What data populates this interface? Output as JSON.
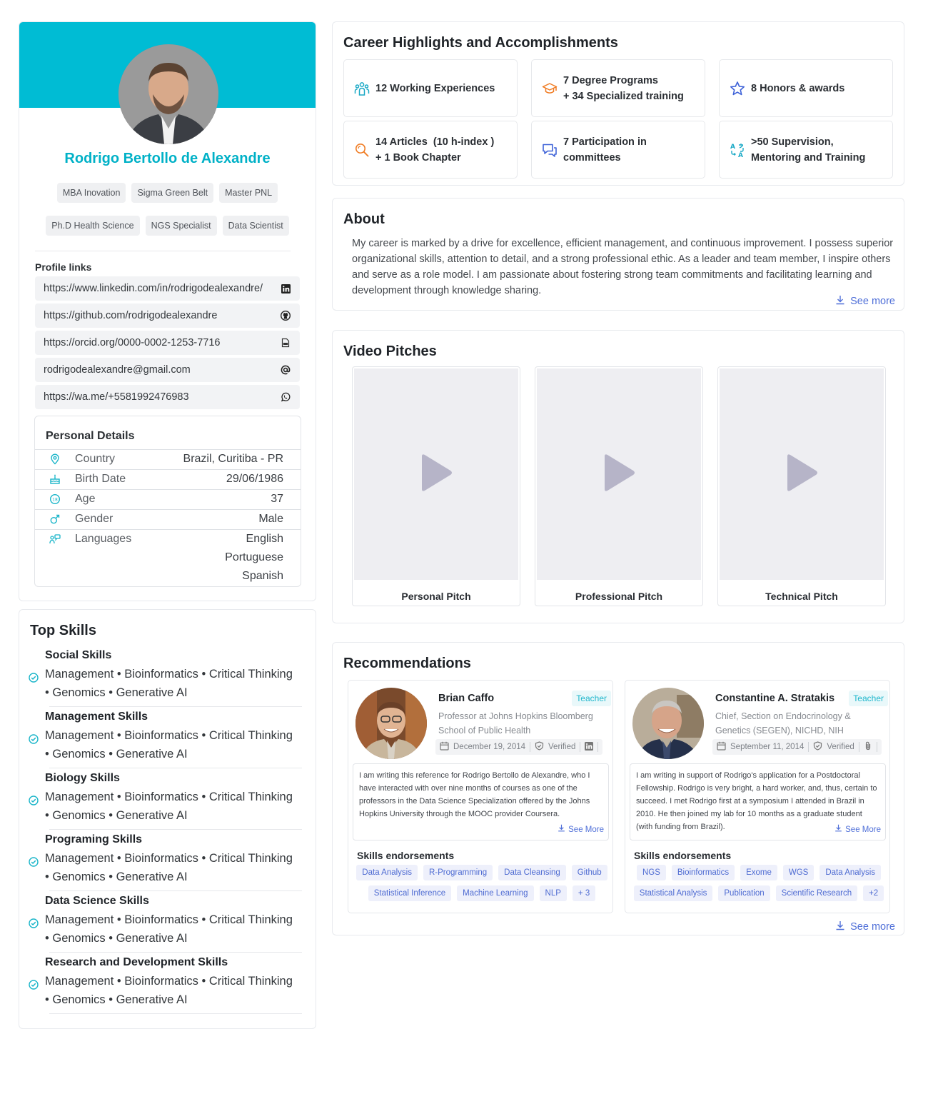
{
  "profile": {
    "name": "Rodrigo Bertollo de Alexandre",
    "tags_row1": [
      "MBA Inovation",
      "Sigma Green Belt",
      "Master PNL"
    ],
    "tags_row2": [
      "Ph.D Health Science",
      "NGS Specialist",
      "Data Scientist"
    ],
    "links_title": "Profile links",
    "links": [
      {
        "text": "https://www.linkedin.com/in/rodrigodealexandre/",
        "icon": "linkedin-icon"
      },
      {
        "text": "https://github.com/rodrigodealexandre",
        "icon": "github-icon"
      },
      {
        "text": "https://orcid.org/0000-0002-1253-7716",
        "icon": "orcid-icon"
      },
      {
        "text": "rodrigodealexandre@gmail.com",
        "icon": "at-icon"
      },
      {
        "text": "https://wa.me/+5581992476983",
        "icon": "whatsapp-icon"
      }
    ],
    "personal": {
      "title": "Personal Details",
      "rows": [
        {
          "label": "Country",
          "value": "Brazil, Curitiba - PR",
          "icon": "location-icon"
        },
        {
          "label": "Birth Date",
          "value": "29/06/1986",
          "icon": "cake-icon"
        },
        {
          "label": "Age",
          "value": "37",
          "icon": "age-icon"
        },
        {
          "label": "Gender",
          "value": "Male",
          "icon": "male-icon"
        },
        {
          "label": "Languages",
          "values": [
            "English",
            "Portuguese",
            "Spanish"
          ],
          "icon": "language-icon"
        }
      ]
    }
  },
  "skills": {
    "title": "Top Skills",
    "groups": [
      {
        "name": "Social Skills",
        "line1": "Management • Bioinformatics • Critical Thinking",
        "line2": "• Genomics • Generative AI"
      },
      {
        "name": "Management Skills",
        "line1": "Management • Bioinformatics • Critical Thinking",
        "line2": "• Genomics • Generative AI"
      },
      {
        "name": "Biology Skills",
        "line1": "Management • Bioinformatics • Critical Thinking",
        "line2": "• Genomics • Generative AI"
      },
      {
        "name": "Programing Skills",
        "line1": "Management • Bioinformatics • Critical Thinking",
        "line2": "• Genomics • Generative AI"
      },
      {
        "name": "Data Science Skills",
        "line1": "Management • Bioinformatics • Critical Thinking",
        "line2": "• Genomics • Generative AI"
      },
      {
        "name": "Research and Development Skills",
        "line1": "Management • Bioinformatics • Critical Thinking",
        "line2": "• Genomics • Generative AI"
      }
    ]
  },
  "career": {
    "title": "Career Highlights and Accomplishments",
    "items": [
      {
        "line1": "12 Working Experiences",
        "line2": "",
        "icon": "team-icon",
        "color": "#1aa9c6"
      },
      {
        "line1": "7 Degree Programs",
        "line2": "+ 34 Specialized training",
        "icon": "graduation-cap-icon",
        "color": "#f07b22"
      },
      {
        "line1": "8 Honors & awards",
        "line2": "",
        "icon": "star-icon",
        "color": "#3f63d8"
      },
      {
        "line1": "14 Articles  (10 h-index )",
        "line2": "+ 1 Book Chapter",
        "icon": "search-doc-icon",
        "color": "#f07b22"
      },
      {
        "line1": "7 Participation in",
        "line2": "committees",
        "icon": "chat-icon",
        "color": "#3f63d8"
      },
      {
        "line1": ">50 Supervision,",
        "line2": "Mentoring and Training",
        "icon": "translate-icon",
        "color": "#1aa9c6"
      }
    ]
  },
  "about": {
    "title": "About",
    "text": "My career is marked by a drive for excellence, efficient management, and continuous improvement. I possess superior organizational skills, attention to detail, and a strong professional ethic. As a leader and team member, I inspire others and serve as a role model. I am passionate about fostering strong team commitments and facilitating learning and development through knowledge sharing.",
    "see_more": "See more"
  },
  "videos": {
    "title": "Video Pitches",
    "items": [
      {
        "label": "Personal Pitch"
      },
      {
        "label": "Professional Pitch"
      },
      {
        "label": "Technical Pitch"
      }
    ]
  },
  "recommendations": {
    "title": "Recommendations",
    "see_more": "See more",
    "items": [
      {
        "name": "Brian Caffo",
        "badge": "Teacher",
        "role": "Professor at Johns Hopkins Bloomberg School of Public Health",
        "date": "December 19, 2014",
        "verified": "Verified",
        "quote": "I am writing this reference for Rodrigo Bertollo de Alexandre, who I have interacted with over nine months of courses as one of the professors in the Data Science Specialization offered by the Johns Hopkins University through the MOOC provider Coursera.",
        "see_more": "See More",
        "endorse_title": "Skills endorsements",
        "tags": [
          "Data Analysis",
          "R-Programming",
          "Data Cleansing",
          "Github",
          "Statistical Inference",
          "Machine Learning",
          "NLP",
          "+ 3"
        ]
      },
      {
        "name": "Constantine A. Stratakis",
        "badge": "Teacher",
        "role": "Chief, Section on Endocrinology & Genetics (SEGEN), NICHD, NIH",
        "date": "September 11, 2014",
        "verified": "Verified",
        "quote": "I am writing in support of Rodrigo's application for a Postdoctoral Fellowship. Rodrigo is very bright, a hard worker, and, thus, certain to succeed. I met Rodrigo first at a symposium I attended in Brazil in 2010. He then joined my lab for 10 months as a graduate student (with funding from Brazil).",
        "see_more": "See More",
        "endorse_title": "Skills endorsements",
        "tags": [
          "NGS",
          "Bioinformatics",
          "Exome",
          "WGS",
          "Data Analysis",
          "Statistical Analysis",
          "Publication",
          "Scientific Research",
          "+2"
        ]
      }
    ]
  },
  "colors": {
    "accent": "#00bcd4",
    "link": "#4f6fd8",
    "teal": "#1aa9c6"
  }
}
